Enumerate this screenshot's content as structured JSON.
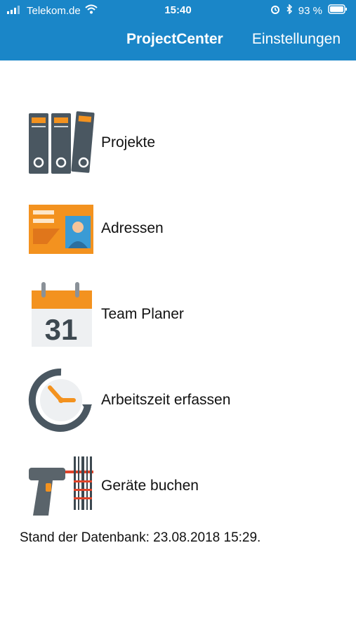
{
  "status_bar": {
    "carrier": "Telekom.de",
    "time": "15:40",
    "battery": "93 %"
  },
  "nav": {
    "title": "ProjectCenter",
    "settings_label": "Einstellungen"
  },
  "menu": {
    "items": [
      {
        "label": "Projekte",
        "icon": "binders-icon"
      },
      {
        "label": "Adressen",
        "icon": "address-card-icon"
      },
      {
        "label": "Team Planer",
        "icon": "calendar-icon",
        "calendar_day": "31"
      },
      {
        "label": "Arbeitszeit erfassen",
        "icon": "clock-icon"
      },
      {
        "label": "Geräte buchen",
        "icon": "barcode-scanner-icon"
      }
    ]
  },
  "footer": {
    "db_status": "Stand der Datenbank: 23.08.2018 15:29."
  },
  "colors": {
    "header": "#1a86c8",
    "accent_orange": "#f3921f",
    "icon_gray": "#4a5761"
  }
}
